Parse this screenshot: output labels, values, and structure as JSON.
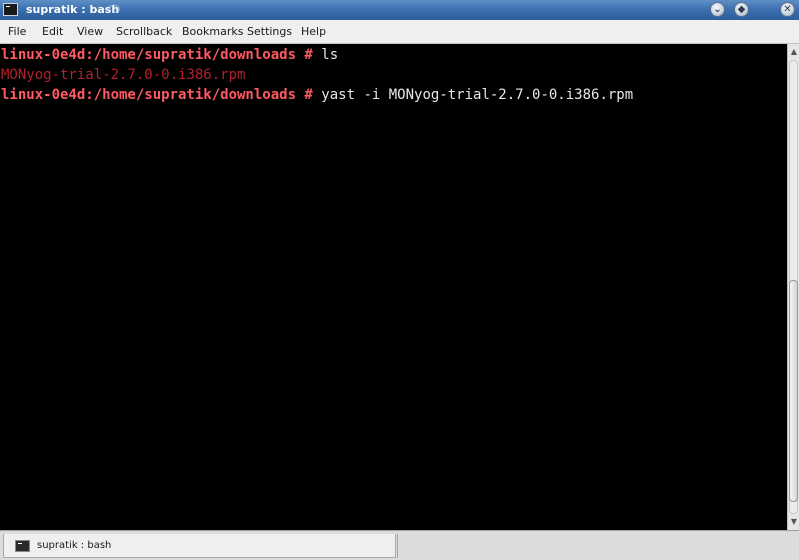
{
  "window": {
    "title": "supratik : bash"
  },
  "menu": [
    {
      "label": "File"
    },
    {
      "label": "Edit"
    },
    {
      "label": "View"
    },
    {
      "label": "Scrollback"
    },
    {
      "label": "Bookmarks"
    },
    {
      "label": "Settings"
    },
    {
      "label": "Help"
    }
  ],
  "terminal": {
    "lines": [
      {
        "prompt": "linux-0e4d:/home/supratik/downloads #",
        "command": " ls"
      },
      {
        "output": "MONyog-trial-2.7.0-0.i386.rpm"
      },
      {
        "prompt": "linux-0e4d:/home/supratik/downloads #",
        "command": " yast -i MONyog-trial-2.7.0-0.i386.rpm"
      }
    ]
  },
  "tabbar": {
    "tab_label": "supratik : bash"
  },
  "colors": {
    "prompt": "#ff5a63",
    "output_file": "#b3202b",
    "command": "#e8e8e8",
    "titlebar": "#3a6eae"
  },
  "icons": {
    "app": "terminal-icon",
    "title_decoration": "chameleon-logo-icon",
    "minimize": "chevron-down-icon",
    "maximize": "diamond-icon",
    "close": "close-icon"
  }
}
